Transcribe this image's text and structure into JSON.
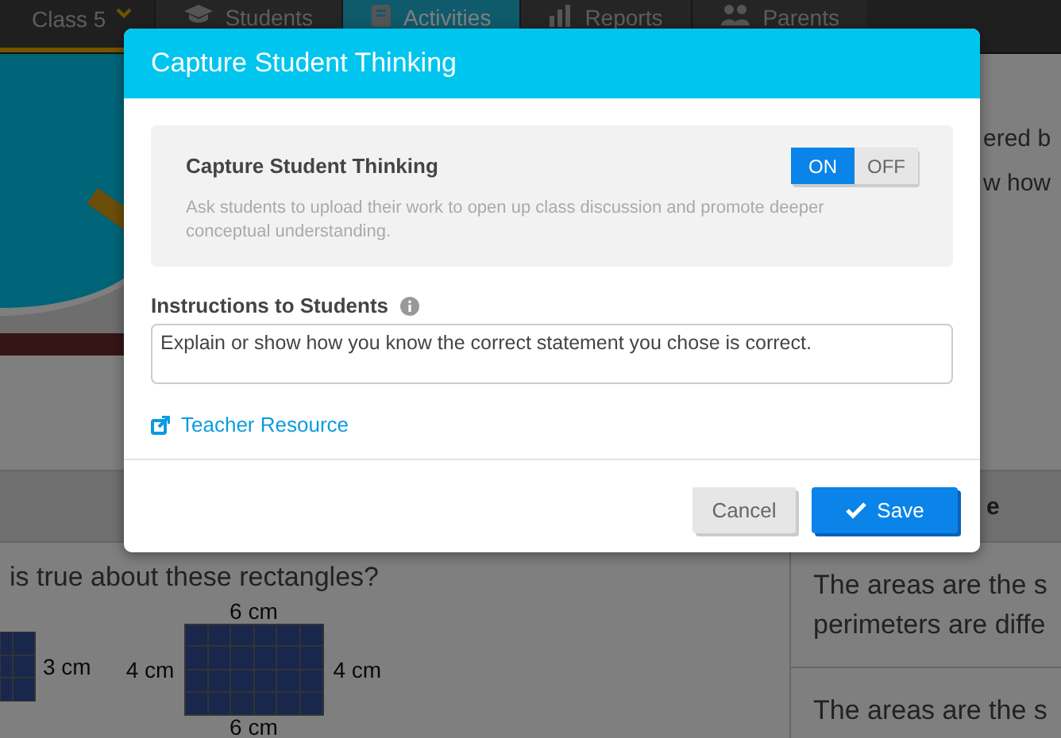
{
  "nav": {
    "class_selector": "Class 5",
    "tabs": [
      {
        "label": "Students",
        "kind": "students",
        "selected": false
      },
      {
        "label": "Activities",
        "kind": "activities",
        "selected": true
      },
      {
        "label": "Reports",
        "kind": "reports",
        "selected": false
      },
      {
        "label": "Parents",
        "kind": "parents",
        "selected": false
      }
    ]
  },
  "background": {
    "intro_lines": [
      "ered b",
      "w how"
    ],
    "column_heading": "e",
    "question": "is true about these rectangles?",
    "rectangles": [
      {
        "right_label": "3 cm"
      },
      {
        "top_label": "6 cm",
        "left_label": "4 cm",
        "right_label": "4 cm",
        "bottom_label": "6 cm"
      }
    ],
    "answers": [
      [
        "The areas are the s",
        "perimeters are diffe"
      ],
      [
        "The areas are the s"
      ]
    ]
  },
  "modal": {
    "title": "Capture Student Thinking",
    "setting": {
      "title": "Capture Student Thinking",
      "options": [
        {
          "label": "ON",
          "selected": true
        },
        {
          "label": "OFF",
          "selected": false
        }
      ],
      "description": "Ask students to upload their work to open up class discussion and promote deeper conceptual understanding."
    },
    "instructions": {
      "label": "Instructions to Students",
      "value": "Explain or show how you know the correct statement you chose is correct."
    },
    "resource_link": "Teacher Resource",
    "buttons": [
      {
        "label": "Cancel",
        "kind": "cancel"
      },
      {
        "label": "Save",
        "kind": "save"
      }
    ]
  }
}
